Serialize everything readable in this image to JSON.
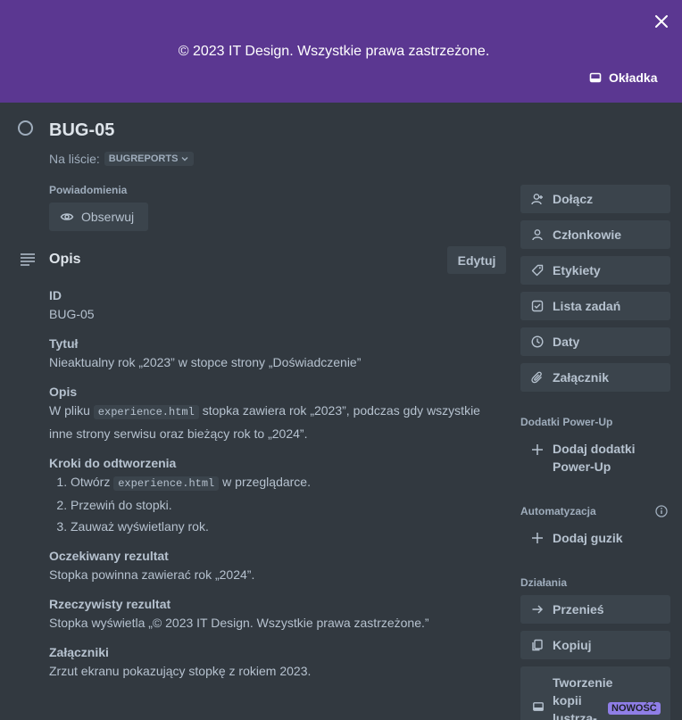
{
  "cover": {
    "text": "© 2023 IT Design. Wszystkie prawa zastrzeżone.",
    "cover_button": "Okładka",
    "background": "#5b3791"
  },
  "card": {
    "title": "BUG-05",
    "list_prefix": "Na liście:",
    "list_name": "BUGREPORTS"
  },
  "notifications": {
    "label": "Powiadomienia",
    "watch_button": "Obserwuj"
  },
  "description": {
    "title": "Opis",
    "edit_button": "Edytuj",
    "id_heading": "ID",
    "id_value": "BUG-05",
    "title_heading": "Tytuł",
    "title_value": "Nieaktualny rok „2023” w stopce strony „Doświadczenie”",
    "desc_heading": "Opis",
    "desc_pre": "W pliku",
    "desc_code": "experience.html",
    "desc_post": "stopka zawiera rok „2023”, podczas gdy wszystkie inne strony serwisu oraz bieżący rok to „2024”.",
    "steps_heading": "Kroki do odtworzenia",
    "step1_pre": "Otwórz",
    "step1_code": "experience.html",
    "step1_post": "w przeglądarce.",
    "step2": "Przewiń do stopki.",
    "step3": "Zauważ wyświetlany rok.",
    "expected_heading": "Oczekiwany rezultat",
    "expected_value": "Stopka powinna zawierać rok „2024”.",
    "actual_heading": "Rzeczywisty rezultat",
    "actual_value": "Stopka wyświetla „© 2023 IT Design. Wszystkie prawa zastrzeżone.”",
    "attachments_heading": "Załączniki",
    "attachments_value": "Zrzut ekranu pokazujący stopkę z rokiem 2023."
  },
  "sidebar": {
    "join": "Dołącz",
    "members": "Członkowie",
    "labels": "Etykiety",
    "checklist": "Lista zadań",
    "dates": "Daty",
    "attachment": "Załącznik",
    "powerups_label": "Dodatki Power-Up",
    "add_powerups": "Dodaj dodatki Power-Up",
    "automation_label": "Automatyzacja",
    "add_button": "Dodaj guzik",
    "actions_label": "Działania",
    "move": "Przenieś",
    "copy": "Kopiuj",
    "mirror": "Tworzenie kopii lustrza-",
    "new_badge": "NOWOŚĆ"
  },
  "icons": [
    "close-icon",
    "card-icon",
    "eye-icon",
    "description-icon",
    "add-user-icon",
    "user-icon",
    "tag-icon",
    "checklist-icon",
    "clock-icon",
    "paperclip-icon",
    "plus-icon",
    "info-icon",
    "arrow-right-icon",
    "copy-icon",
    "mirror-icon",
    "chevron-down-icon"
  ]
}
